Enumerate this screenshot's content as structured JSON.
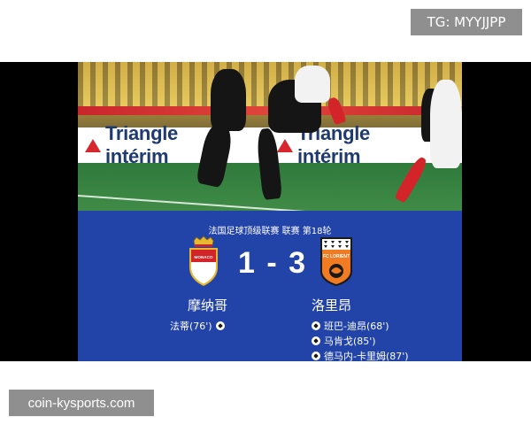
{
  "overlay": {
    "tg_label": "TG: MYYJJPP",
    "watermark": "coin-kysports.com"
  },
  "photo": {
    "banner_brand": "Triangle intérim"
  },
  "match": {
    "league_info": "法国足球顶级联赛 联赛 第18轮",
    "score": "1 - 3",
    "home": {
      "name": "摩纳哥",
      "crest_text": "MONACO",
      "scorers": [
        "法蒂(76')"
      ]
    },
    "away": {
      "name": "洛里昂",
      "crest_text": "FC LORIENT",
      "scorers": [
        "班巴-迪昂(68')",
        "马肯戈(85')",
        "德马内-卡里姆(87')"
      ]
    }
  },
  "colors": {
    "panel_blue": "#2243a8",
    "monaco_red": "#d3242a",
    "lorient_orange": "#f07b22",
    "badge_gray": "#8f8f8f"
  }
}
